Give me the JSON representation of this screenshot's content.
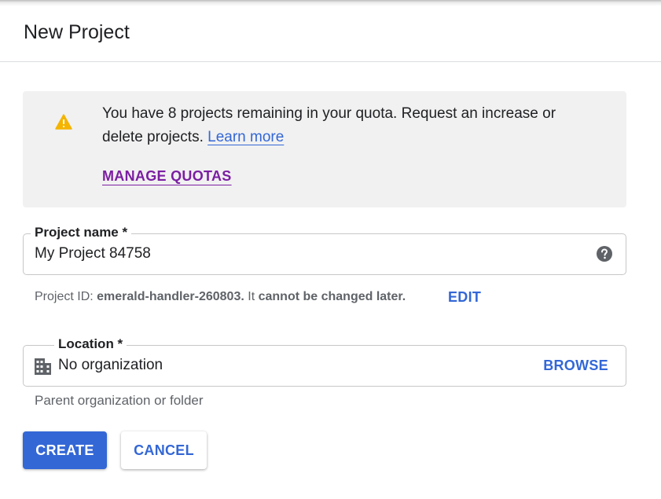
{
  "dialog": {
    "title": "New Project"
  },
  "quota": {
    "message": "You have 8 projects remaining in your quota. Request an increase or delete projects.",
    "learn_more": "Learn more",
    "manage_quotas": "MANAGE QUOTAS",
    "icon": "warning-icon",
    "icon_color": "#f4b400"
  },
  "project_name": {
    "label": "Project name *",
    "value": "My Project 84758",
    "help_icon": "help-icon"
  },
  "project_id": {
    "prefix": "Project ID:",
    "id": "emerald-handler-260803.",
    "middle": "It",
    "emphasis": "cannot be changed later.",
    "edit_label": "EDIT"
  },
  "location": {
    "label": "Location *",
    "value": "No organization",
    "icon": "building-icon",
    "browse_label": "BROWSE",
    "hint": "Parent organization or folder"
  },
  "actions": {
    "create_label": "CREATE",
    "cancel_label": "CANCEL"
  },
  "colors": {
    "primary": "#3367d6",
    "manage_link": "#7b1fa2"
  }
}
